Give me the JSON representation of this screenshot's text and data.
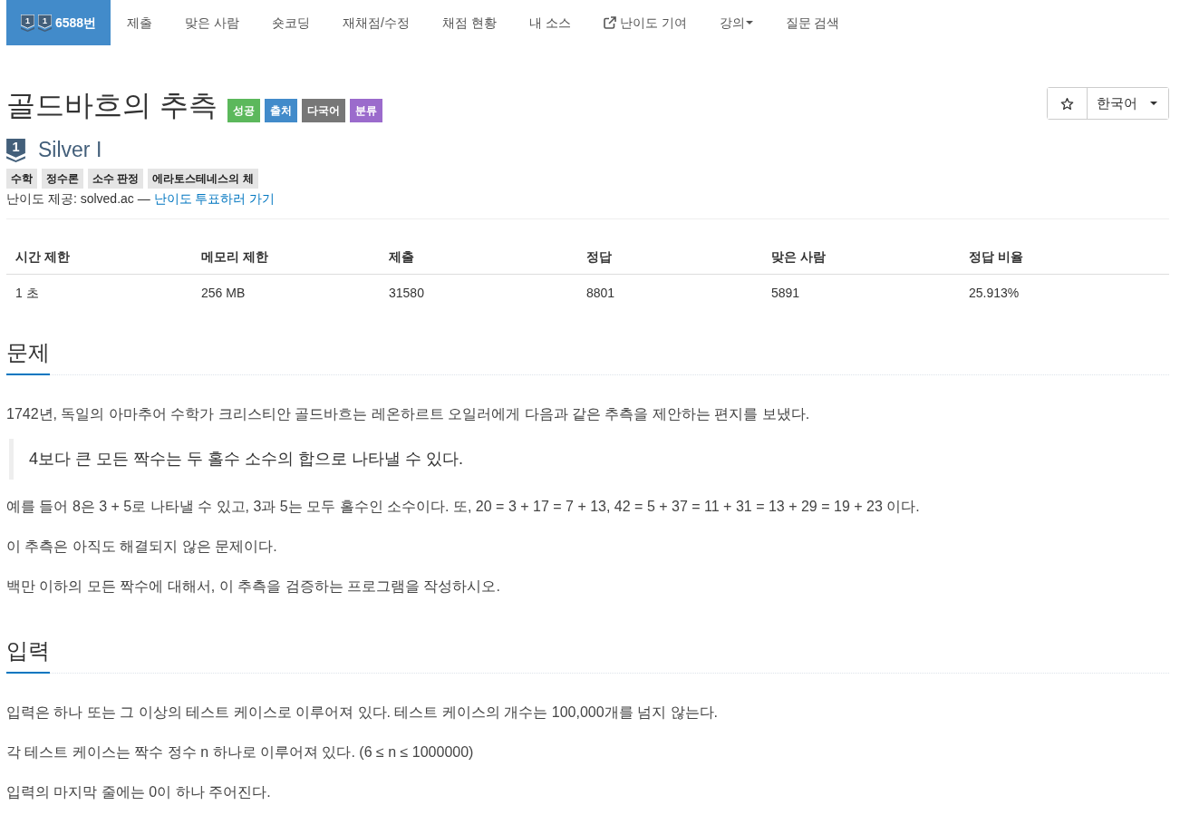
{
  "nav": {
    "items": [
      {
        "label": "6588번",
        "selected": true,
        "kind": "problem",
        "badges": [
          "1",
          "1"
        ]
      },
      {
        "label": "제출",
        "selected": false,
        "kind": "link"
      },
      {
        "label": "맞은 사람",
        "selected": false,
        "kind": "link"
      },
      {
        "label": "숏코딩",
        "selected": false,
        "kind": "link"
      },
      {
        "label": "재채점/수정",
        "selected": false,
        "kind": "link"
      },
      {
        "label": "채점 현황",
        "selected": false,
        "kind": "link"
      },
      {
        "label": "내 소스",
        "selected": false,
        "kind": "link"
      },
      {
        "label": "난이도 기여",
        "selected": false,
        "kind": "external"
      },
      {
        "label": "강의",
        "selected": false,
        "kind": "dropdown"
      },
      {
        "label": "질문 검색",
        "selected": false,
        "kind": "link"
      }
    ]
  },
  "problem": {
    "title": "골드바흐의 추측",
    "labels": [
      {
        "text": "성공",
        "color": "#5cb85c"
      },
      {
        "text": "출처",
        "color": "#428bca"
      },
      {
        "text": "다국어",
        "color": "#777777"
      },
      {
        "text": "분류",
        "color": "#9b6bcc"
      }
    ],
    "language": "한국어",
    "tier": {
      "badge": "1",
      "name": "Silver I"
    },
    "tags": [
      "수학",
      "정수론",
      "소수 판정",
      "에라토스테네스의 체"
    ],
    "difficulty_note": {
      "text": "난이도 제공: solved.ac —",
      "link": "난이도 투표하러 가기"
    }
  },
  "info_table": {
    "columns": [
      "시간 제한",
      "메모리 제한",
      "제출",
      "정답",
      "맞은 사람",
      "정답 비율"
    ],
    "rows": [
      [
        "1 초",
        "256 MB",
        "31580",
        "8801",
        "5891",
        "25.913%"
      ]
    ]
  },
  "sections": [
    {
      "title": "문제",
      "blocks": [
        {
          "kind": "paragraph",
          "text": "1742년, 독일의 아마추어 수학가 크리스티안 골드바흐는 레온하르트 오일러에게 다음과 같은 추측을 제안하는 편지를 보냈다."
        },
        {
          "kind": "quote",
          "text": "4보다 큰 모든 짝수는 두 홀수 소수의 합으로 나타낼 수 있다."
        },
        {
          "kind": "paragraph",
          "text": "예를 들어 8은 3 + 5로 나타낼 수 있고, 3과 5는 모두 홀수인 소수이다. 또, 20 = 3 + 17 = 7 + 13, 42 = 5 + 37 = 11 + 31 = 13 + 29 = 19 + 23 이다."
        },
        {
          "kind": "paragraph",
          "text": "이 추측은 아직도 해결되지 않은 문제이다."
        },
        {
          "kind": "paragraph",
          "text": "백만 이하의 모든 짝수에 대해서, 이 추측을 검증하는 프로그램을 작성하시오."
        }
      ]
    },
    {
      "title": "입력",
      "blocks": [
        {
          "kind": "paragraph",
          "text": "입력은 하나 또는 그 이상의 테스트 케이스로 이루어져 있다. 테스트 케이스의 개수는 100,000개를 넘지 않는다."
        },
        {
          "kind": "paragraph",
          "text": "각 테스트 케이스는 짝수 정수 n 하나로 이루어져 있다. (6 ≤ n ≤ 1000000)"
        },
        {
          "kind": "paragraph",
          "text": "입력의 마지막 줄에는 0이 하나 주어진다."
        }
      ]
    }
  ]
}
